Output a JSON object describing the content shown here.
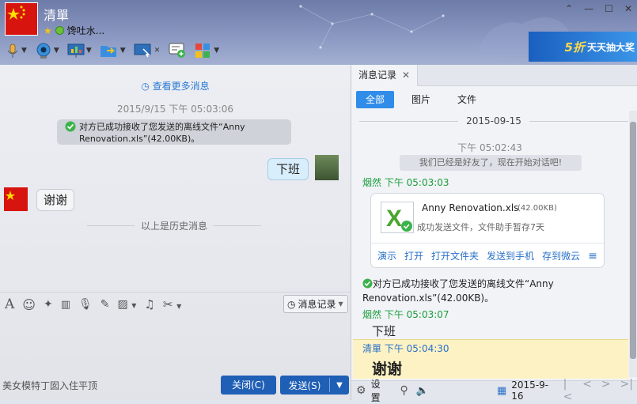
{
  "header": {
    "contact_name": "清單",
    "status_text": "馋吐水...",
    "banner_brand": "5折",
    "banner_text": "天天抽大奖"
  },
  "window_controls": [
    "pin",
    "minimize",
    "maximize",
    "close"
  ],
  "toolbar_icons": [
    "microphone-icon",
    "camera-icon",
    "screen-share-icon",
    "send-file-icon",
    "remote-assist-icon",
    "add-chat-icon",
    "apps-icon"
  ],
  "chat": {
    "view_more": "查看更多消息",
    "timestamp": "2015/9/15 下午 05:03:06",
    "system_message": "对方已成功接收了您发送的离线文件“Anny Renovation.xls”(42.00KB)。",
    "my_message": "下班",
    "their_message": "谢谢",
    "history_divider": "以上是历史消息"
  },
  "input_area": {
    "history_button": "消息记录",
    "footer_text": "美女模特丁囡入住平顶",
    "close_button": "关闭(C)",
    "send_button": "发送(S)"
  },
  "history_panel": {
    "tab_label": "消息记录",
    "filters": [
      "全部",
      "图片",
      "文件"
    ],
    "active_filter": "全部",
    "date": "2015-09-15",
    "time1": "下午 05:02:43",
    "notice": "我们已经是好友了，现在开始对话吧!",
    "sender1": "烟然 下午 05:03:03",
    "file": {
      "name": "Anny Renovation.xls",
      "size": "(42.00KB)",
      "status": "成功发送文件，文件助手暂存7天",
      "actions": [
        "演示",
        "打开",
        "打开文件夹",
        "发送到手机",
        "存到微云"
      ]
    },
    "system_message": "对方已成功接收了您发送的离线文件“Anny Renovation.xls”(42.00KB)。",
    "sender2": "烟然 下午 05:03:07",
    "message2": "下班",
    "sender3": "清單 下午 05:04:30",
    "message3": "谢谢",
    "settings_label": "设置",
    "footer_date": "2015-9-16"
  },
  "colors": {
    "accent_blue": "#2f8ce8",
    "button_blue": "#1f5fb5",
    "sender_green": "#1b9e3a",
    "highlight_row": "#fdf2c4"
  }
}
